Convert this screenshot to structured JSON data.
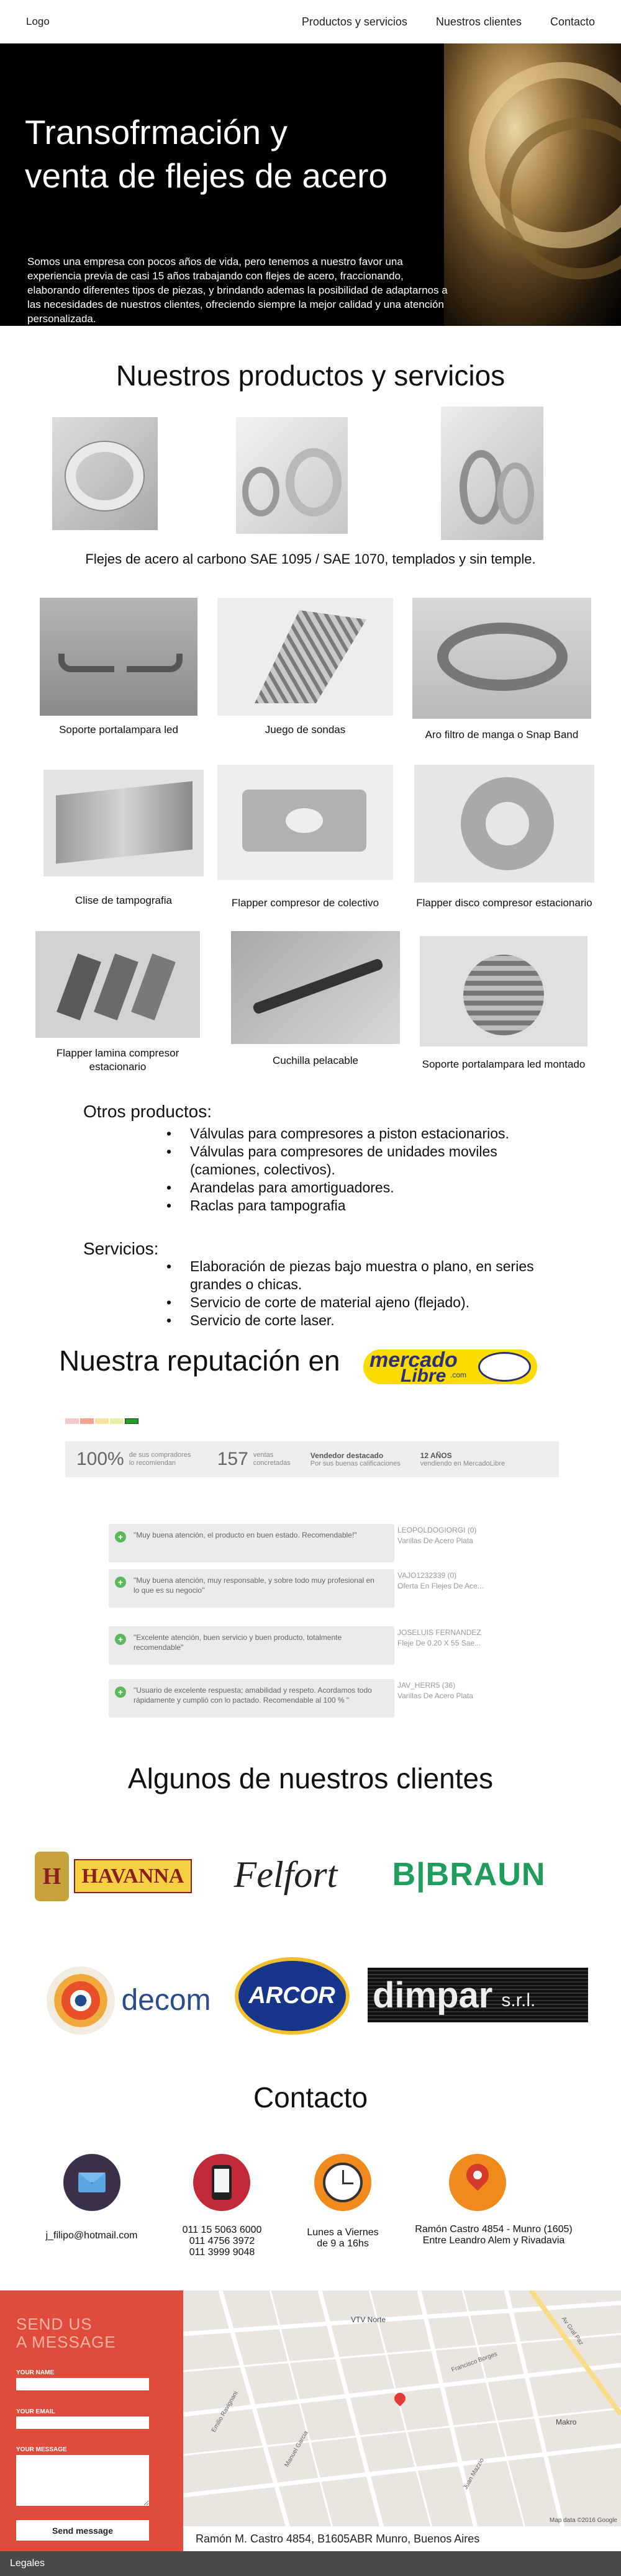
{
  "nav": {
    "logo": "Logo",
    "links": [
      "Productos y servicios",
      "Nuestros clientes",
      "Contacto"
    ]
  },
  "hero": {
    "title_line1": "Transofrmación y",
    "title_line2": "venta de flejes de acero",
    "body": "Somos una empresa con pocos años de vida, pero tenemos a nuestro favor una experiencia previa de casi 15 años  trabajando con flejes de acero, fraccionando, elaborando  diferentes tipos de piezas, y brindando ademas la posibilidad de   adaptarnos a las necesidades de nuestros clientes, ofreciendo siempre la mejor calidad y una atención personalizada."
  },
  "products": {
    "title": "Nuestros productos y servicios",
    "flejes_caption": "Flejes de acero al carbono SAE 1095 / SAE 1070, templados y sin temple.",
    "items": [
      "Soporte portalampara led",
      "Juego de sondas",
      "Aro filtro de manga o Snap Band",
      "Clise de tampografia",
      "Flapper compresor de colectivo",
      "Flapper disco compresor estacionario",
      "Flapper lamina compresor estacionario",
      "Cuchilla pelacable",
      "Soporte portalampara led montado"
    ]
  },
  "otros": {
    "title": "Otros productos:",
    "items": [
      "Válvulas para compresores a piston estacionarios.",
      "Válvulas para compresores de unidades moviles (camiones, colectivos).",
      "Arandelas para amortiguadores.",
      "Raclas para tampografia"
    ]
  },
  "servicios": {
    "title": "Servicios:",
    "items": [
      "Elaboración de piezas bajo muestra o plano, en series grandes o chicas.",
      "Servicio de corte de material ajeno (flejado).",
      "Servicio de corte laser."
    ]
  },
  "reputation": {
    "title": "Nuestra reputación en",
    "logo_top": "mercado",
    "logo_bottom": "Libre",
    "logo_suffix": ".com",
    "pct": "100%",
    "pct_label": "de sus compradores lo recomiendan",
    "sales": "157",
    "sales_label": "ventas concretadas",
    "seller_title": "Vendedor destacado",
    "seller_sub": "Por sus buenas calificaciones",
    "years_title": "12 AÑOS",
    "years_sub": "vendiendo en MercadoLibre",
    "reviews": [
      {
        "text": "\"Muy buena atención, el producto en buen estado. Recomendable!\"",
        "user": "LEOPOLDOGIORGI (0)",
        "item": "Varillas De Acero Plata"
      },
      {
        "text": "\"Muy buena atención, muy responsable, y sobre todo muy profesional en lo que es su negocio\"",
        "user": "VAJO1232339 (0)",
        "item": "Oferta En Flejes De Ace..."
      },
      {
        "text": "\"Excelente atención, buen servicio y buen producto, totalmente recomendable\"",
        "user": "JOSELUIS FERNANDEZ",
        "item": "Fleje De 0.20 X 55 Sae..."
      },
      {
        "text": "\"Usuario de excelente respuesta; amabilidad y respeto. Acordamos todo rápidamente y cumplió con lo pactado. Recomendable al 100 % \"",
        "user": "JAV_HERR5 (36)",
        "item": "Varillas De Acero Plata"
      }
    ]
  },
  "clients": {
    "title": "Algunos de nuestros clientes",
    "names": [
      "HAVANNA",
      "Felfort",
      "B|BRAUN",
      "decom",
      "ARCOR",
      "dimpar",
      "s.r.l."
    ]
  },
  "contact": {
    "title": "Contacto",
    "email": "j_filipo@hotmail.com",
    "phone1": "011 15 5063 6000",
    "phone2": "011 4756 3972",
    "phone3": "011 3999 9048",
    "hours1": "Lunes a Viernes",
    "hours2": "de 9 a 16hs",
    "addr1": "Ramón Castro 4854 - Munro (1605)",
    "addr2": "Entre Leandro Alem y Rivadavia"
  },
  "form": {
    "title1": "SEND US",
    "title2": "A MESSAGE",
    "name_label": "YOUR NAME",
    "email_label": "YOUR EMAIL",
    "message_label": "YOUR MESSAGE",
    "send": "Send message"
  },
  "map": {
    "address": "Ramón M. Castro 4854, B1605ABR Munro, Buenos Aires",
    "credit": "Map data ©2016 Google",
    "streets": [
      "VTV Norte",
      "Makro",
      "Emilio Ravignani",
      "Francisco Borges",
      "Manuel Garcia",
      "Juan Mazzio",
      "Av Gral Paz"
    ]
  },
  "footer": {
    "legales": "Legales"
  }
}
